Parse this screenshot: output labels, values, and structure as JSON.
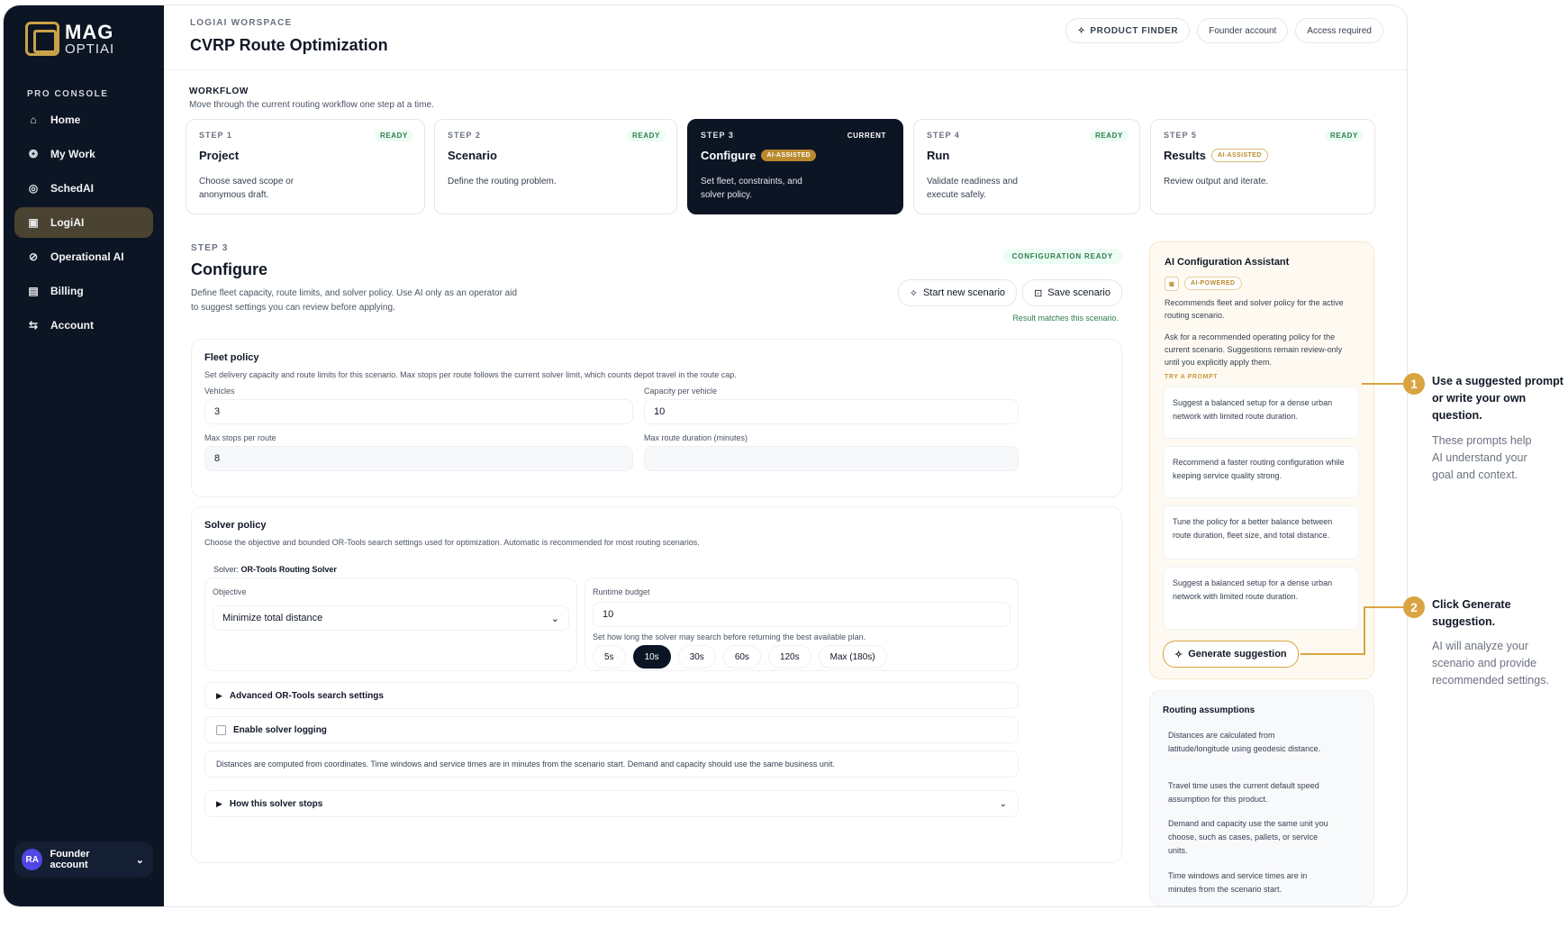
{
  "brand": {
    "name_top": "MAG",
    "name_bottom": "OPTIAI"
  },
  "sidebar": {
    "section_label": "PRO CONSOLE",
    "items": [
      {
        "label": "Home",
        "icon": "home-icon",
        "glyph": "⌂"
      },
      {
        "label": "My Work",
        "icon": "work-icon",
        "glyph": "❂"
      },
      {
        "label": "SchedAI",
        "icon": "sched-icon",
        "glyph": "◎"
      },
      {
        "label": "LogiAI",
        "icon": "logi-icon",
        "glyph": "▣",
        "active": true
      },
      {
        "label": "Operational AI",
        "icon": "ops-icon",
        "glyph": "⊘"
      },
      {
        "label": "Billing",
        "icon": "billing-icon",
        "glyph": "▤"
      },
      {
        "label": "Account",
        "icon": "account-icon",
        "glyph": "⇆"
      }
    ],
    "user": {
      "initials": "RA",
      "name": "Founder account"
    }
  },
  "header": {
    "workspace": "LOGIAI WORSPACE",
    "title": "CVRP Route Optimization",
    "buttons": {
      "product_finder": "PRODUCT FINDER",
      "account": "Founder account",
      "access": "Access required"
    }
  },
  "workflow": {
    "title": "WORKFLOW",
    "subtitle": "Move through the current routing workflow one step at a time.",
    "steps": [
      {
        "no": "STEP 1",
        "tag": "READY",
        "name": "Project",
        "badge": "",
        "desc": "Choose saved scope or anonymous draft."
      },
      {
        "no": "STEP 2",
        "tag": "READY",
        "name": "Scenario",
        "badge": "",
        "desc": "Define the routing problem."
      },
      {
        "no": "STEP 3",
        "tag": "CURRENT",
        "name": "Configure",
        "badge": "AI-ASSISTED",
        "desc": "Set fleet, constraints, and solver policy."
      },
      {
        "no": "STEP 4",
        "tag": "READY",
        "name": "Run",
        "badge": "",
        "desc": "Validate readiness and execute safely."
      },
      {
        "no": "STEP 5",
        "tag": "READY",
        "name": "Results",
        "badge": "AI-ASSISTED",
        "desc": "Review output and iterate."
      }
    ]
  },
  "configure": {
    "step": "STEP 3",
    "title": "Configure",
    "desc": "Define fleet capacity, route limits, and solver policy. Use AI only as an operator aid to suggest settings you can review before applying.",
    "status": "CONFIGURATION READY",
    "start_btn": "Start new scenario",
    "save_btn": "Save scenario",
    "match_note": "Result matches this scenario."
  },
  "fleet": {
    "title": "Fleet policy",
    "subtitle": "Set delivery capacity and route limits for this scenario. Max stops per route follows the current solver limit, which counts depot travel in the route cap.",
    "vehicles_label": "Vehicles",
    "vehicles": "3",
    "capacity_label": "Capacity per vehicle",
    "capacity": "10",
    "max_stops_label": "Max stops per route",
    "max_stops": "8",
    "max_duration_label": "Max route duration (minutes)",
    "max_duration": ""
  },
  "solver": {
    "title": "Solver policy",
    "subtitle": "Choose the objective and bounded OR-Tools search settings used for optimization. Automatic is recommended for most routing scenarios.",
    "solver_prefix": "Solver:",
    "solver_name": "OR-Tools Routing Solver",
    "objective_label": "Objective",
    "objective": "Minimize total distance",
    "runtime_label": "Runtime budget",
    "runtime": "10",
    "runtime_hint": "Set how long the solver may search before returning the best available plan.",
    "chips": [
      "5s",
      "10s",
      "30s",
      "60s",
      "120s",
      "Max (180s)"
    ],
    "selected_chip": "10s",
    "advanced": "Advanced OR-Tools search settings",
    "logging": "Enable solver logging",
    "note": "Distances are computed from coordinates. Time windows and service times are in minutes from the scenario start. Demand and capacity should use the same business unit.",
    "how": "How this solver stops"
  },
  "assistant": {
    "title": "AI Configuration Assistant",
    "badge": "AI-POWERED",
    "text1": "Recommends fleet and solver policy for the active routing scenario.",
    "text2": "Ask for a recommended operating policy for the current scenario. Suggestions remain review-only until you explicitly apply them.",
    "try_label": "TRY A PROMPT",
    "prompts": [
      "Suggest a balanced setup for a dense urban network with limited route duration.",
      "Recommend a faster routing configuration while keeping service quality strong.",
      "Tune the policy for a better balance between route duration, fleet size, and total distance.",
      "Suggest a balanced setup for a dense urban network with limited route duration."
    ],
    "generate": "Generate suggestion"
  },
  "assumptions": {
    "title": "Routing assumptions",
    "items": [
      "Distances are calculated from latitude/longitude using geodesic distance.",
      "Travel time uses the current default speed assumption for this product.",
      "Demand and capacity use the same unit you choose, such as cases, pallets, or service units.",
      "Time windows and service times are in minutes from the scenario start."
    ]
  },
  "callouts": [
    {
      "num": "1",
      "title": "Use a suggested prompt or write your own question.",
      "body": "These prompts help AI understand your goal and context."
    },
    {
      "num": "2",
      "title": "Click Generate suggestion.",
      "body": "AI will analyze your scenario and provide recommended settings."
    }
  ],
  "colors": {
    "sidebar": "#0c1524",
    "accent_gold": "#d9a441",
    "ready_green": "#2f7d4f"
  }
}
